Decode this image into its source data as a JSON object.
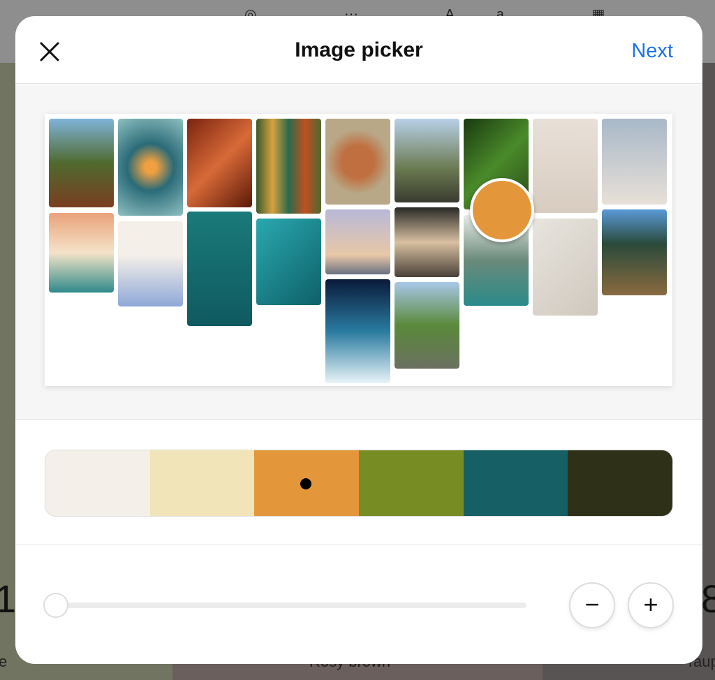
{
  "header": {
    "title": "Image picker",
    "next_label": "Next",
    "close_icon": "close-icon"
  },
  "background": {
    "labels": [
      "e",
      "Rosy brown",
      "Taup"
    ],
    "numbers": [
      "1",
      "8"
    ]
  },
  "picker": {
    "selected_color": "#e4973a"
  },
  "palette": {
    "swatches": [
      "#f4efe8",
      "#f0e4b8",
      "#e4973a",
      "#788c24",
      "#155f65",
      "#2e3118"
    ],
    "selected_index": 2
  },
  "zoom": {
    "slider_value": 0,
    "minus_label": "−",
    "plus_label": "+"
  }
}
